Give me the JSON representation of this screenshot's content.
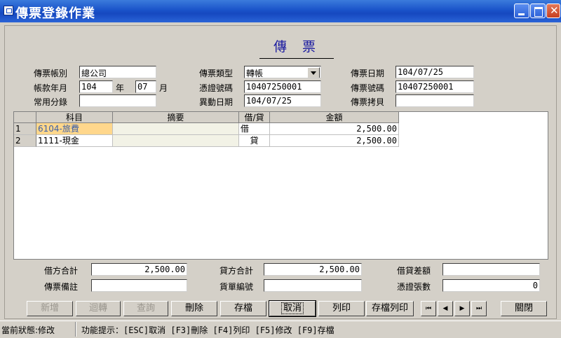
{
  "window": {
    "title": "傳票登錄作業"
  },
  "form": {
    "heading": "傳票",
    "labels": {
      "voucher_book": "傳票帳別",
      "account_ym": "帳款年月",
      "year_unit": "年",
      "month_unit": "月",
      "common_entry": "常用分錄",
      "voucher_type": "傳票類型",
      "voucher_no_doc": "憑證號碼",
      "change_date": "異動日期",
      "voucher_date": "傳票日期",
      "voucher_number": "傳票號碼",
      "voucher_copies": "傳票拷貝"
    },
    "values": {
      "voucher_book": "總公司",
      "year": "104",
      "month": "07",
      "common_entry": "",
      "voucher_type": "轉帳",
      "voucher_no_doc": "10407250001",
      "change_date": "104/07/25",
      "voucher_date": "104/07/25",
      "voucher_number": "10407250001",
      "voucher_copies": ""
    }
  },
  "grid": {
    "headers": [
      "科目",
      "摘要",
      "借/貸",
      "金額"
    ],
    "rows": [
      {
        "no": "1",
        "account": "6104-旅費",
        "summary": "",
        "dc": "借",
        "amount": "2,500.00"
      },
      {
        "no": "2",
        "account": "1111-現金",
        "summary": "",
        "dc": "貸",
        "amount": "2,500.00"
      }
    ]
  },
  "totals": {
    "labels": {
      "debit_total": "借方合計",
      "credit_total": "貸方合計",
      "diff": "借貸差額",
      "remark": "傳票備註",
      "bill_no": "貨單編號",
      "doc_count": "憑證張數"
    },
    "values": {
      "debit_total": "2,500.00",
      "credit_total": "2,500.00",
      "diff": "",
      "remark": "",
      "bill_no": "",
      "doc_count": "0"
    }
  },
  "buttons": {
    "add": "新增",
    "reverse": "迴轉",
    "query": "查詢",
    "delete": "刪除",
    "save": "存檔",
    "cancel": "取消",
    "print": "列印",
    "save_print": "存檔列印",
    "close": "關閉"
  },
  "status": {
    "state": "當前狀態:修改",
    "tip": "功能提示：[ESC]取消 [F3]刪除 [F4]列印 [F5]修改 [F9]存檔"
  },
  "colors": {
    "titlebar": "#1548c0",
    "highlight_cell": "#ffd78c",
    "heading": "#1a1aa0",
    "account_text": "#3a5fa8"
  }
}
